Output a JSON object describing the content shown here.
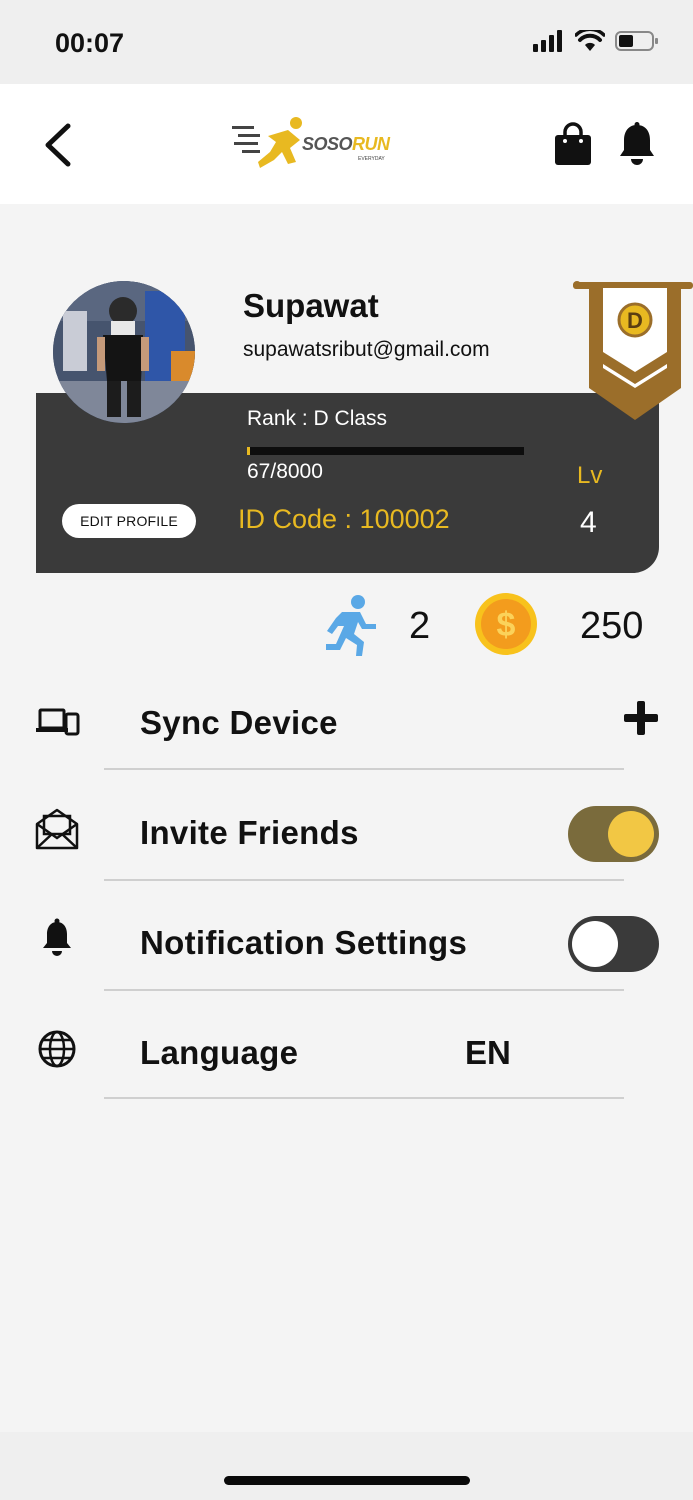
{
  "status_bar": {
    "time": "00:07"
  },
  "header": {
    "logo_text_soso": "SOSO",
    "logo_text_run": "RUN",
    "logo_sub": "EVERYDAY"
  },
  "profile": {
    "name": "Supawat",
    "email": "supawatsribut@gmail.com",
    "rank_label": "Rank : D Class",
    "rank_progress": "67/8000",
    "rank_progress_fraction": 0.0084,
    "edit_button": "EDIT PROFILE",
    "id_code": "ID Code : 100002",
    "level_label": "Lv",
    "level_value": "4",
    "rank_badge": "D"
  },
  "stats": {
    "runs": "2",
    "coins": "250"
  },
  "menu": [
    {
      "label": "Sync Device",
      "icon": "devices-icon",
      "action": "plus-icon"
    },
    {
      "label": "Invite Friends",
      "icon": "envelope-icon",
      "toggle": true
    },
    {
      "label": "Notification Settings",
      "icon": "bell-icon",
      "toggle": false
    },
    {
      "label": "Language",
      "icon": "globe-icon",
      "value": "EN"
    }
  ],
  "colors": {
    "accent": "#e8b921",
    "card_dark": "#3a3a3a",
    "toggle_on_track": "#7a6b3c",
    "toggle_on_knob": "#f2c744",
    "banner": "#9b6e2a",
    "run_icon": "#5aa8e6"
  }
}
